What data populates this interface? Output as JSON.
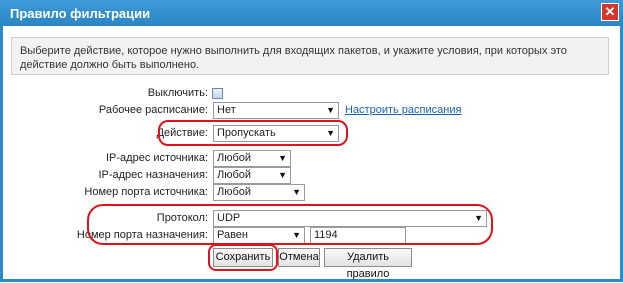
{
  "dialog": {
    "title": "Правило фильтрации",
    "close_glyph": "✕"
  },
  "info": {
    "text": "Выберите действие, которое нужно выполнить для входящих пакетов, и укажите условия, при которых это действие должно быть выполнено."
  },
  "form": {
    "disable_label": "Выключить:",
    "schedule_label": "Рабочее расписание:",
    "schedule_value": "Нет",
    "schedule_link": "Настроить расписания",
    "action_label": "Действие:",
    "action_value": "Пропускать",
    "src_ip_label": "IP-адрес источника:",
    "src_ip_value": "Любой",
    "dst_ip_label": "IP-адрес назначения:",
    "dst_ip_value": "Любой",
    "src_port_label": "Номер порта источника:",
    "src_port_value": "Любой",
    "protocol_label": "Протокол:",
    "protocol_value": "UDP",
    "dst_port_label": "Номер порта назначения:",
    "dst_port_mode": "Равен",
    "dst_port_value": "1194"
  },
  "buttons": {
    "save": "Сохранить",
    "cancel": "Отмена",
    "delete": "Удалить правило"
  },
  "colors": {
    "titlebar": "#2d8bc9",
    "highlight": "#e0131c",
    "link": "#1a5fb4"
  }
}
